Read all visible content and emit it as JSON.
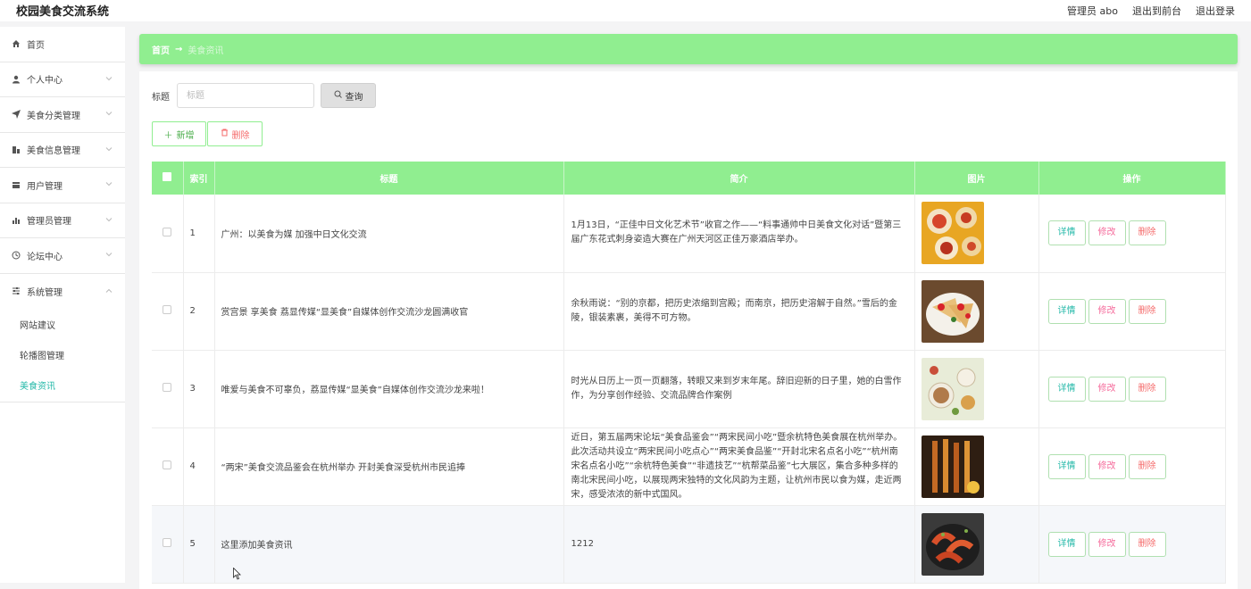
{
  "app": {
    "title": "校园美食交流系统"
  },
  "header": {
    "admin_label": "管理员 abo",
    "front_link": "退出到前台",
    "logout_link": "退出登录"
  },
  "sidebar": {
    "items": [
      {
        "label": "首页",
        "icon": "home-icon"
      },
      {
        "label": "个人中心",
        "icon": "user-icon"
      },
      {
        "label": "美食分类管理",
        "icon": "send-icon"
      },
      {
        "label": "美食信息管理",
        "icon": "chart-icon"
      },
      {
        "label": "用户管理",
        "icon": "tray-icon"
      },
      {
        "label": "管理员管理",
        "icon": "bars-icon"
      },
      {
        "label": "论坛中心",
        "icon": "clock-icon"
      },
      {
        "label": "系统管理",
        "icon": "sliders-icon"
      }
    ],
    "sub_items": [
      {
        "label": "网站建议"
      },
      {
        "label": "轮播图管理"
      },
      {
        "label": "美食资讯",
        "active": true
      }
    ]
  },
  "breadcrumb": {
    "home": "首页",
    "separator": "→",
    "current": "美食资讯"
  },
  "search": {
    "label": "标题",
    "placeholder": "标题",
    "button": "查询"
  },
  "actions": {
    "add": "新增",
    "delete": "删除"
  },
  "table": {
    "columns": [
      "索引",
      "标题",
      "简介",
      "图片",
      "操作"
    ],
    "rows": [
      {
        "index": "1",
        "title": "广州：以美食为媒 加强中日文化交流",
        "intro": "1月13日，“正佳中日文化艺术节”收官之作——“料事通帅中日美食文化对话”暨第三届广东花式刺身姿造大赛在广州天河区正佳万豪酒店举办。",
        "image": "dumplings-photo"
      },
      {
        "index": "2",
        "title": "赏宫景 享美食 荔显传媒“显美食”自媒体创作交流沙龙圆满收官",
        "intro": "余秋雨说：“别的京都，把历史浓缩到宫殿；而南京，把历史溶解于自然。”雪后的金陵，银装素裹，美得不可方物。",
        "image": "crepes-photo"
      },
      {
        "index": "3",
        "title": "唯爱与美食不可辜负，荔显传媒“显美食”自媒体创作交流沙龙来啦！",
        "intro": "时光从日历上一页一页翻落，转眼又来到岁末年尾。辞旧迎新的日子里，她的白雪作作，为分享创作经验、交流品牌合作案例",
        "image": "tea-table-photo"
      },
      {
        "index": "4",
        "title": "“两宋”美食交流品鉴会在杭州举办 开封美食深受杭州市民追捧",
        "intro": "近日，第五届两宋论坛“美食品鉴会”“两宋民间小吃”暨余杭特色美食展在杭州举办。此次活动共设立“两宋民间小吃点心”“两宋美食品鉴”“开封北宋名点名小吃”“杭州南宋名点名小吃”“余杭特色美食”“非遗技艺”“杭帮菜品鉴”七大展区，集合多种多样的南北宋民间小吃，以展现两宋独特的文化风韵为主题，让杭州市民以食为媒，走近两宋，感受浓浓的新中式国风。",
        "image": "skewers-photo"
      },
      {
        "index": "5",
        "title": "这里添加美食资讯",
        "intro": "1212",
        "image": "shrimp-photo"
      }
    ],
    "op_labels": {
      "detail": "详情",
      "edit": "修改",
      "remove": "删除"
    }
  },
  "colors": {
    "accent": "#90ee90",
    "teal": "#23b8a8",
    "danger": "#f56c6c"
  }
}
